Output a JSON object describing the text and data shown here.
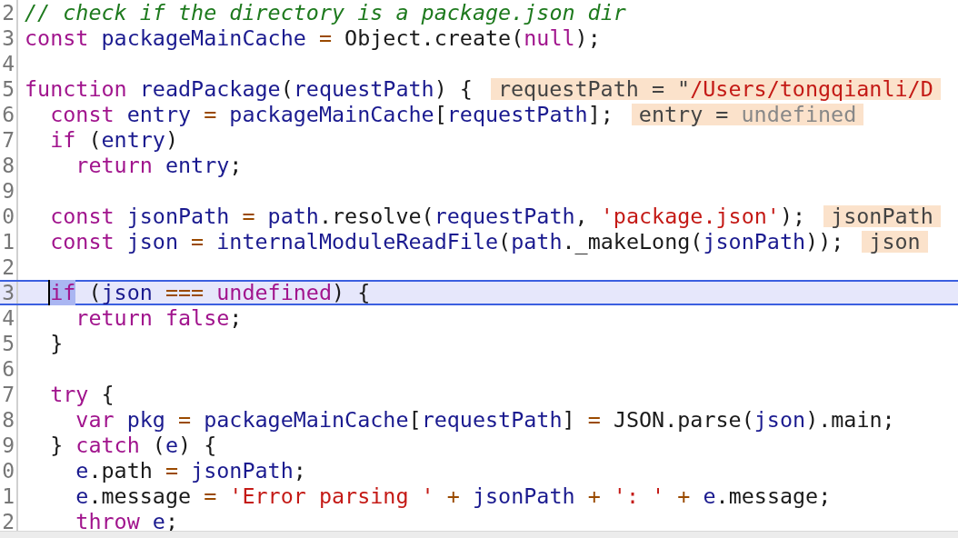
{
  "editor": {
    "lines": [
      {
        "num": "2",
        "current": false,
        "tokens": [
          {
            "t": "// check if the directory is a package.json dir",
            "kind": "comment"
          }
        ]
      },
      {
        "num": "3",
        "current": false,
        "tokens": [
          {
            "t": "const ",
            "kind": "keyword"
          },
          {
            "t": "packageMainCache ",
            "kind": "variable"
          },
          {
            "t": "= ",
            "kind": "operator"
          },
          {
            "t": "Object.create(",
            "kind": "plain"
          },
          {
            "t": "null",
            "kind": "keyword"
          },
          {
            "t": ");",
            "kind": "plain"
          }
        ]
      },
      {
        "num": "4",
        "current": false
      },
      {
        "num": "5",
        "current": false,
        "tokens": [
          {
            "t": "function ",
            "kind": "keyword"
          },
          {
            "t": "readPackage",
            "kind": "variable"
          },
          {
            "t": "(",
            "kind": "plain"
          },
          {
            "t": "requestPath",
            "kind": "variable"
          },
          {
            "t": ") {",
            "kind": "plain"
          }
        ],
        "inline": [
          {
            "t": "requestPath = \"",
            "kind": "name"
          },
          {
            "t": "/Users/tongqianli/D",
            "kind": "string"
          }
        ]
      },
      {
        "num": "6",
        "current": false,
        "tokens": [
          {
            "t": "  const ",
            "kind": "keyword"
          },
          {
            "t": "entry ",
            "kind": "variable"
          },
          {
            "t": "= ",
            "kind": "operator"
          },
          {
            "t": "packageMainCache",
            "kind": "variable"
          },
          {
            "t": "[",
            "kind": "plain"
          },
          {
            "t": "requestPath",
            "kind": "variable"
          },
          {
            "t": "];",
            "kind": "plain"
          }
        ],
        "inline": [
          {
            "t": "entry = ",
            "kind": "name"
          },
          {
            "t": "undefined",
            "kind": "undefined"
          }
        ]
      },
      {
        "num": "7",
        "current": false,
        "tokens": [
          {
            "t": "  if ",
            "kind": "keyword"
          },
          {
            "t": "(",
            "kind": "plain"
          },
          {
            "t": "entry",
            "kind": "variable"
          },
          {
            "t": ")",
            "kind": "plain"
          }
        ]
      },
      {
        "num": "8",
        "current": false,
        "tokens": [
          {
            "t": "    return ",
            "kind": "keyword"
          },
          {
            "t": "entry",
            "kind": "variable"
          },
          {
            "t": ";",
            "kind": "plain"
          }
        ]
      },
      {
        "num": "9",
        "current": false
      },
      {
        "num": "0",
        "current": false,
        "tokens": [
          {
            "t": "  const ",
            "kind": "keyword"
          },
          {
            "t": "jsonPath ",
            "kind": "variable"
          },
          {
            "t": "= ",
            "kind": "operator"
          },
          {
            "t": "path",
            "kind": "variable"
          },
          {
            "t": ".resolve(",
            "kind": "plain"
          },
          {
            "t": "requestPath",
            "kind": "variable"
          },
          {
            "t": ", ",
            "kind": "plain"
          },
          {
            "t": "'package.json'",
            "kind": "string"
          },
          {
            "t": ");",
            "kind": "plain"
          }
        ],
        "inline": [
          {
            "t": "jsonPath",
            "kind": "name"
          }
        ]
      },
      {
        "num": "1",
        "current": false,
        "tokens": [
          {
            "t": "  const ",
            "kind": "keyword"
          },
          {
            "t": "json ",
            "kind": "variable"
          },
          {
            "t": "= ",
            "kind": "operator"
          },
          {
            "t": "internalModuleReadFile",
            "kind": "variable"
          },
          {
            "t": "(",
            "kind": "plain"
          },
          {
            "t": "path",
            "kind": "variable"
          },
          {
            "t": "._makeLong(",
            "kind": "plain"
          },
          {
            "t": "jsonPath",
            "kind": "variable"
          },
          {
            "t": "));",
            "kind": "plain"
          }
        ],
        "inline": [
          {
            "t": "json",
            "kind": "name"
          }
        ]
      },
      {
        "num": "2",
        "current": false
      },
      {
        "num": "3",
        "current": true,
        "tokens": [
          {
            "t": "  if",
            "kind": "selection"
          },
          {
            "t": " (",
            "kind": "plain"
          },
          {
            "t": "json ",
            "kind": "variable"
          },
          {
            "t": "=== ",
            "kind": "operator"
          },
          {
            "t": "undefined",
            "kind": "keyword"
          },
          {
            "t": ") {",
            "kind": "plain"
          }
        ]
      },
      {
        "num": "4",
        "current": false,
        "tokens": [
          {
            "t": "    return false",
            "kind": "keyword"
          },
          {
            "t": ";",
            "kind": "plain"
          }
        ]
      },
      {
        "num": "5",
        "current": false,
        "tokens": [
          {
            "t": "  }",
            "kind": "plain"
          }
        ]
      },
      {
        "num": "6",
        "current": false
      },
      {
        "num": "7",
        "current": false,
        "tokens": [
          {
            "t": "  try ",
            "kind": "keyword"
          },
          {
            "t": "{",
            "kind": "plain"
          }
        ]
      },
      {
        "num": "8",
        "current": false,
        "tokens": [
          {
            "t": "    var ",
            "kind": "keyword"
          },
          {
            "t": "pkg ",
            "kind": "variable"
          },
          {
            "t": "= ",
            "kind": "operator"
          },
          {
            "t": "packageMainCache",
            "kind": "variable"
          },
          {
            "t": "[",
            "kind": "plain"
          },
          {
            "t": "requestPath",
            "kind": "variable"
          },
          {
            "t": "] ",
            "kind": "plain"
          },
          {
            "t": "= ",
            "kind": "operator"
          },
          {
            "t": "JSON.parse(",
            "kind": "plain"
          },
          {
            "t": "json",
            "kind": "variable"
          },
          {
            "t": ").main;",
            "kind": "plain"
          }
        ]
      },
      {
        "num": "9",
        "current": false,
        "tokens": [
          {
            "t": "  } ",
            "kind": "plain"
          },
          {
            "t": "catch ",
            "kind": "keyword"
          },
          {
            "t": "(",
            "kind": "plain"
          },
          {
            "t": "e",
            "kind": "variable"
          },
          {
            "t": ") {",
            "kind": "plain"
          }
        ]
      },
      {
        "num": "0",
        "current": false,
        "tokens": [
          {
            "t": "    e",
            "kind": "variable"
          },
          {
            "t": ".path ",
            "kind": "plain"
          },
          {
            "t": "= ",
            "kind": "operator"
          },
          {
            "t": "jsonPath",
            "kind": "variable"
          },
          {
            "t": ";",
            "kind": "plain"
          }
        ]
      },
      {
        "num": "1",
        "current": false,
        "tokens": [
          {
            "t": "    e",
            "kind": "variable"
          },
          {
            "t": ".message ",
            "kind": "plain"
          },
          {
            "t": "= ",
            "kind": "operator"
          },
          {
            "t": "'Error parsing ' ",
            "kind": "string"
          },
          {
            "t": "+ ",
            "kind": "operator"
          },
          {
            "t": "jsonPath ",
            "kind": "variable"
          },
          {
            "t": "+ ",
            "kind": "operator"
          },
          {
            "t": "': ' ",
            "kind": "string"
          },
          {
            "t": "+ ",
            "kind": "operator"
          },
          {
            "t": "e",
            "kind": "variable"
          },
          {
            "t": ".message;",
            "kind": "plain"
          }
        ]
      },
      {
        "num": "2",
        "current": false,
        "tokens": [
          {
            "t": "    throw ",
            "kind": "keyword"
          },
          {
            "t": "e",
            "kind": "variable"
          },
          {
            "t": ";",
            "kind": "plain"
          }
        ]
      }
    ]
  }
}
